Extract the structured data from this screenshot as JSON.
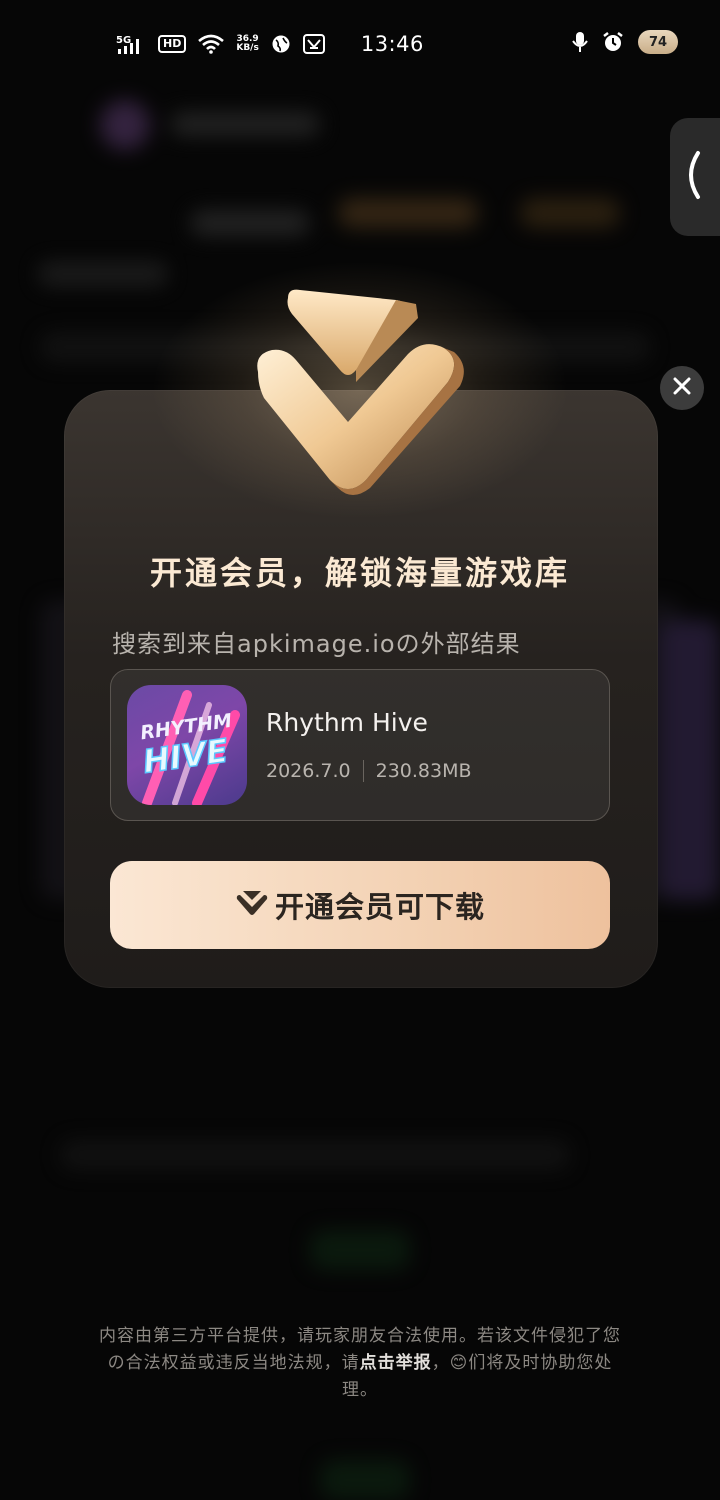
{
  "status_bar": {
    "network": "5G",
    "hd": "HD",
    "speed_value": "36.9",
    "speed_unit": "KB/s",
    "time": "13:46",
    "battery": "74"
  },
  "modal": {
    "title": "开通会员，解锁海量游戏库",
    "subtitle": "搜索到来自apkimage.ioの外部结果",
    "app": {
      "name": "Rhythm Hive",
      "version": "2026.7.0",
      "size": "230.83MB",
      "icon_text_top": "RHYTHM",
      "icon_text_bottom": "HIVE"
    },
    "cta_label": "开通会员可下载"
  },
  "footer": {
    "disclaimer_pre": "内容由第三方平台提供，请玩家朋友合法使用。若该文件侵犯了您の合法权益或违反当地法规，请",
    "report_link": "点击举报",
    "disclaimer_post": "，😊们将及时协助您处理。"
  },
  "colors": {
    "accent": "#f3d2b4",
    "title": "#fbe9d3",
    "modal_bg": "#2a2522"
  }
}
